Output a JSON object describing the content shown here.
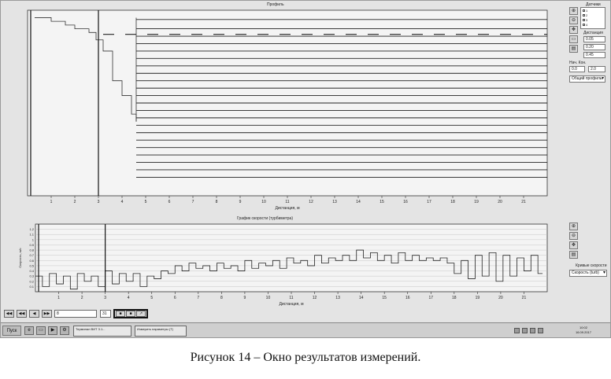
{
  "caption": "Рисунок 14 – Окно результатов измерений.",
  "profile_panel": {
    "title": "Профиль",
    "xlabel": "Дистанция, м"
  },
  "speed_panel": {
    "title": "График скорости (турбиметра)",
    "ylabel": "Скорость, м/с",
    "xlabel": "Дистанция, м"
  },
  "right_panel": {
    "sensors_label": "Датчики",
    "sensors": [
      "1",
      "2",
      "3",
      "4"
    ],
    "distance_label": "Дистанция",
    "distance_values": [
      "0.05",
      "0.20",
      "0.45"
    ],
    "depth_label": "Нач.  Кон.",
    "depth_start": "0.0",
    "depth_end": "2.0",
    "profile_combo": "Общий профиль",
    "speed_label": "Кривые скорости",
    "speed_combo": "Скорость (turb)"
  },
  "nav": {
    "btn_first": "◀◀",
    "btn_prev": "◀◀",
    "btn_back": "◀",
    "btn_next": "▶▶",
    "field_value": "8",
    "field_value2": "31",
    "btn_a": "■",
    "btn_b": "■",
    "btn_c": "↗"
  },
  "taskbar": {
    "start": "Пуск",
    "task1": "Терминал ВИТ 3.1...",
    "task2": "Измерить параметры (T)",
    "clock_time": "10:02",
    "clock_date": "16.09.2017"
  },
  "chart_data": [
    {
      "type": "line",
      "title": "Профиль",
      "xlabel": "Дистанция, м",
      "xlim": [
        0,
        22
      ],
      "ylim": [
        0,
        1
      ],
      "x_ticks": [
        "1",
        "2",
        "3",
        "4",
        "5",
        "6",
        "7",
        "8",
        "9",
        "10",
        "11",
        "12",
        "13",
        "14",
        "15",
        "16",
        "17",
        "18",
        "19",
        "20",
        "21"
      ],
      "horizontal_levels": [
        0.95,
        0.9,
        0.86,
        0.82,
        0.78,
        0.74,
        0.7,
        0.66,
        0.62,
        0.58,
        0.54,
        0.5,
        0.46,
        0.42,
        0.38,
        0.34,
        0.3,
        0.26,
        0.22,
        0.18,
        0.14,
        0.1
      ],
      "profile_step": {
        "x": [
          0.3,
          1.0,
          1.6,
          2.0,
          2.6,
          2.9,
          3.2,
          3.6,
          4.0,
          4.4,
          4.6
        ],
        "y": [
          0.96,
          0.94,
          0.92,
          0.9,
          0.88,
          0.84,
          0.78,
          0.62,
          0.54,
          0.44,
          0.4
        ]
      },
      "dashed_level": 0.87,
      "cursor_x": 3.0
    },
    {
      "type": "line",
      "title": "График скорости (турбиметра)",
      "xlabel": "Дистанция, м",
      "ylabel": "Скорость, м/с",
      "xlim": [
        0,
        22
      ],
      "ylim": [
        0,
        1.3
      ],
      "x_ticks": [
        "1",
        "2",
        "3",
        "4",
        "5",
        "6",
        "7",
        "8",
        "9",
        "10",
        "11",
        "12",
        "13",
        "14",
        "15",
        "16",
        "17",
        "18",
        "19",
        "20",
        "21"
      ],
      "y_ticks": [
        "0.1",
        "0.2",
        "0.3",
        "0.4",
        "0.5",
        "0.6",
        "0.7",
        "0.8",
        "0.9",
        "1",
        "1.1",
        "1.2"
      ],
      "cursor_x": 3.0,
      "series": [
        {
          "x": [
            0.0,
            0.3,
            0.6,
            0.9,
            1.2,
            1.5,
            1.8,
            2.1,
            2.4,
            2.7,
            3.0,
            3.3,
            3.6,
            3.9,
            4.2,
            4.5,
            4.8,
            5.1,
            5.4,
            5.7,
            6.0,
            6.3,
            6.6,
            6.9,
            7.2,
            7.5,
            7.8,
            8.1,
            8.4,
            8.7,
            9.0,
            9.3,
            9.6,
            9.9,
            10.2,
            10.5,
            10.8,
            11.1,
            11.4,
            11.7,
            12.0,
            12.3,
            12.6,
            12.9,
            13.2,
            13.5,
            13.8,
            14.1,
            14.4,
            14.7,
            15.0,
            15.3,
            15.6,
            15.9,
            16.2,
            16.5,
            16.8,
            17.1,
            17.4,
            17.7,
            18.0,
            18.3,
            18.6,
            18.9,
            19.2,
            19.5,
            19.8,
            20.1,
            20.4,
            20.7,
            21.0,
            21.3,
            21.6
          ],
          "y": [
            0.3,
            0.1,
            0.35,
            0.15,
            0.3,
            0.05,
            0.35,
            0.2,
            0.3,
            0.1,
            0.4,
            0.15,
            0.35,
            0.2,
            0.35,
            0.1,
            0.3,
            0.25,
            0.4,
            0.35,
            0.5,
            0.4,
            0.55,
            0.45,
            0.5,
            0.4,
            0.55,
            0.45,
            0.5,
            0.4,
            0.6,
            0.45,
            0.55,
            0.5,
            0.6,
            0.45,
            0.65,
            0.55,
            0.6,
            0.5,
            0.7,
            0.55,
            0.65,
            0.6,
            0.7,
            0.6,
            0.8,
            0.65,
            0.75,
            0.6,
            0.7,
            0.55,
            0.75,
            0.6,
            0.7,
            0.6,
            0.65,
            0.6,
            0.65,
            0.55,
            0.35,
            0.6,
            0.25,
            0.7,
            0.3,
            0.75,
            0.2,
            0.7,
            0.3,
            0.65,
            0.4,
            0.7,
            0.35
          ]
        }
      ]
    }
  ]
}
